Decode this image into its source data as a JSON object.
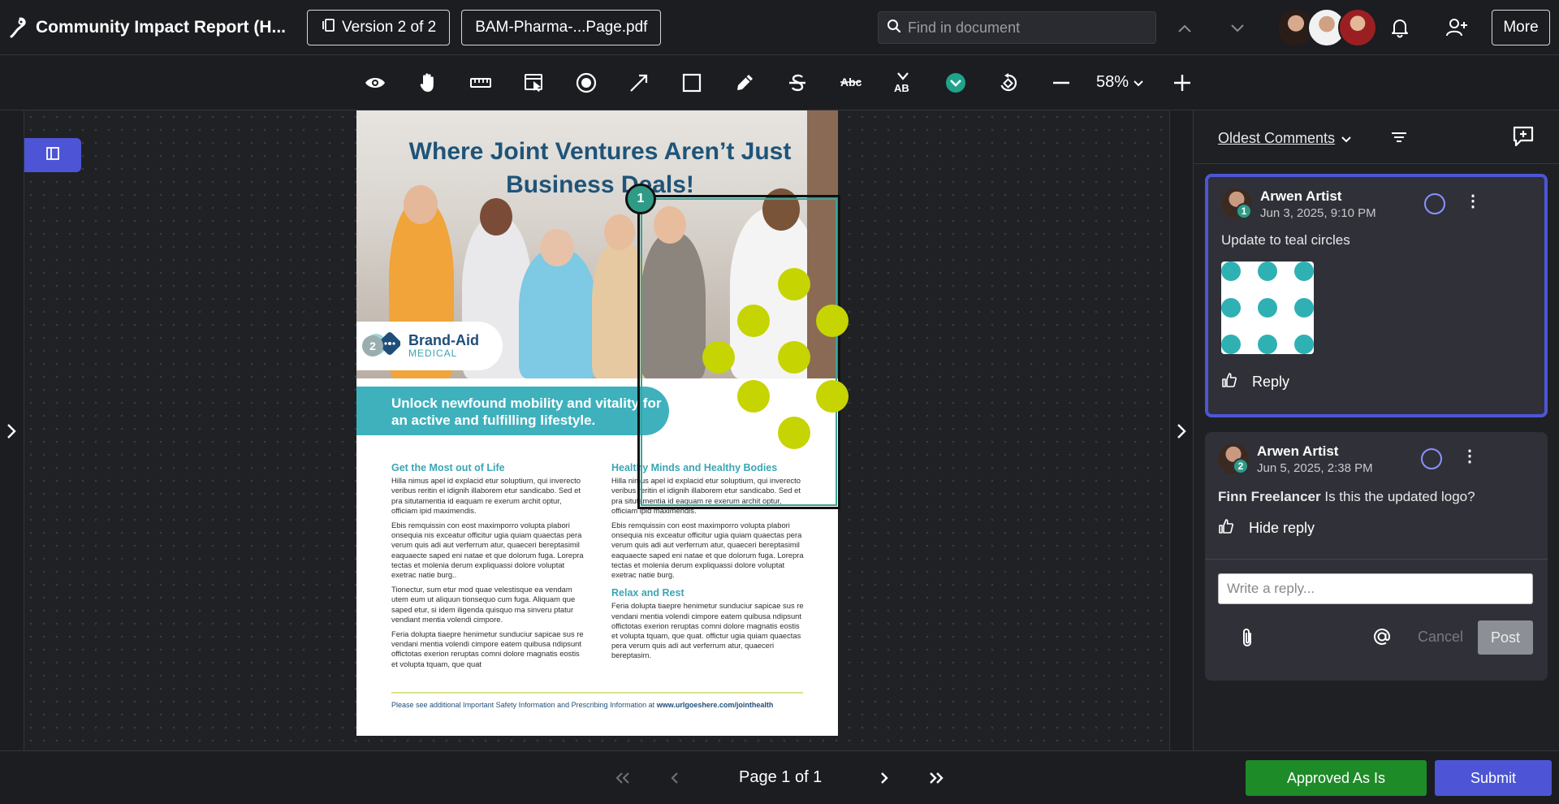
{
  "header": {
    "title": "Community Impact Report (H...",
    "version_label": "Version 2 of 2",
    "file_label": "BAM-Pharma-...Page.pdf",
    "find_placeholder": "Find in document",
    "more_label": "More"
  },
  "toolbar": {
    "tools": [
      "eye-icon",
      "hand-icon",
      "ruler-icon",
      "select-area-icon",
      "record-circle-icon",
      "arrow-icon",
      "rectangle-icon",
      "pencil-icon",
      "strikethrough-icon",
      "replace-text-icon",
      "insert-text-icon",
      "approve-check-icon",
      "rotate-icon",
      "zoom-out-icon"
    ],
    "zoom_label": "58%"
  },
  "document": {
    "headline": "Where Joint Ventures Aren’t Just Business Deals!",
    "brand_name": "Brand-Aid",
    "brand_sub": "MEDICAL",
    "band_text": "Unlock newfound mobility and vitality for an active and fulfilling lifestyle.",
    "col1_heading": "Get the Most out of Life",
    "col1_p1": "Hilla nimus apel id explacid etur soluptium, qui inverecto veribus reritin el idignih illaborem etur sandicabo. Sed et pra situtamentia id eaquam re exerum archit optur, officiam ipid maximendis.",
    "col1_p2": "Ebis remquissin con eost maximporro volupta plabori onsequia nis exceatur officitur ugia quiam quaectas pera verum quis adi aut verferrum atur, quaeceri bereptasimil eaquaecte saped eni natae et que dolorum fuga. Lorepra tectas et molenia derum expliquassi dolore voluptat exetrac natie burg..",
    "col1_p3": "Tionectur, sum etur mod quae velestisque ea vendam utem eum ut aliquun tionsequo cum fuga. Aliquam que saped etur, si idem iligenda quisquo ma sinveru ptatur vendiant mentia volendi cimpore.",
    "col1_p4": "Feria dolupta tiaepre henimetur sunduciur sapicae sus re vendani mentia volendi cimpore eatem quibusa ndipsunt offictotas exerion reruptas comni dolore magnatis eostis et volupta tquam, que quat",
    "col2_heading": "Healthy Minds and Healthy Bodies",
    "col2_p1": "Hilla nimus apel id explacid etur soluptium, qui inverecto veribus reritin el idignih illaborem etur sandicabo. Sed et pra situtamentia id eaquam re exerum archit optur, officiam ipid maximendis.",
    "col2_p2": "Ebis remquissin con eost maximporro volupta plabori onsequia nis exceatur officitur ugia quiam quaectas pera verum quis adi aut verferrum atur, quaeceri bereptasimil eaquaecte saped eni natae et que dolorum fuga. Lorepra tectas et molenia derum expliquassi dolore voluptat exetrac natie burg.",
    "col2_heading2": "Relax and Rest",
    "col2_p3": "Feria dolupta tiaepre henimetur sunduciur sapicae sus re vendani mentia volendi cimpore eatem quibusa ndipsunt offictotas exerion reruptas comni dolore magnatis eostis et volupta tquam, que quat. offictur ugia quiam quaectas pera verum quis adi aut verferrum atur, quaeceri bereptasim.",
    "footer_text": "Please see additional Important Safety Information and Prescribing Information at",
    "footer_link": "www.urlgoeshere.com/jointhealth",
    "pin1": "1",
    "pin2": "2"
  },
  "comments_panel": {
    "sort_label": "Oldest Comments",
    "comments": [
      {
        "number": "1",
        "author": "Arwen Artist",
        "date": "Jun 3, 2025, 9:10 PM",
        "text": "Update to teal circles",
        "reply_label": "Reply"
      },
      {
        "number": "2",
        "author": "Arwen Artist",
        "date": "Jun 5, 2025, 2:38 PM",
        "mention": "Finn Freelancer",
        "text": "Is this the updated logo?",
        "reply_label": "Hide reply",
        "reply_placeholder": "Write a reply...",
        "cancel_label": "Cancel",
        "post_label": "Post"
      }
    ]
  },
  "footer": {
    "page_label": "Page 1 of 1",
    "approve_label": "Approved As Is",
    "submit_label": "Submit"
  },
  "colors": {
    "accent": "#4d55d6",
    "approve": "#1e8b29",
    "teal": "#3fb1bd",
    "lime": "#c6d402"
  }
}
